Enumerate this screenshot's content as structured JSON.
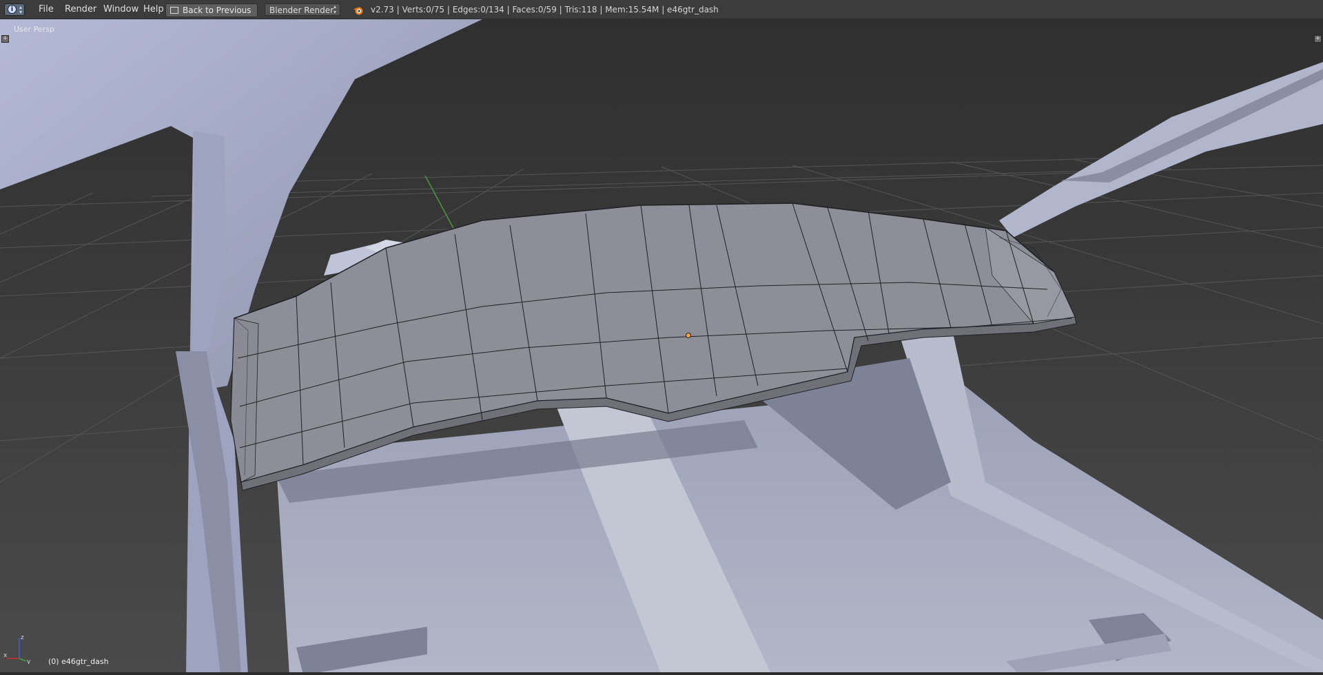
{
  "header": {
    "editor_type_icon": "info-icon",
    "menus": [
      "File",
      "Render",
      "Window",
      "Help"
    ],
    "back_button": "Back to Previous",
    "render_engine": "Blender Render",
    "logo_icon": "blender-logo-icon",
    "stats": "v2.73 | Verts:0/75 | Edges:0/134 | Faces:0/59 | Tris:118 | Mem:15.54M | e46gtr_dash"
  },
  "viewport": {
    "view_label": "User Persp",
    "object_label": "(0) e46gtr_dash",
    "gizmo": {
      "z": "z",
      "x": "x",
      "y": "y"
    }
  },
  "colors": {
    "header_bg": "#3c3c3c",
    "viewport_bg": "#393939",
    "grid": "#4a4a4a",
    "mesh_face": "#8e8e98",
    "wire": "#1f1f24",
    "car_body": "#a9aec8",
    "origin": "#ffa040"
  }
}
